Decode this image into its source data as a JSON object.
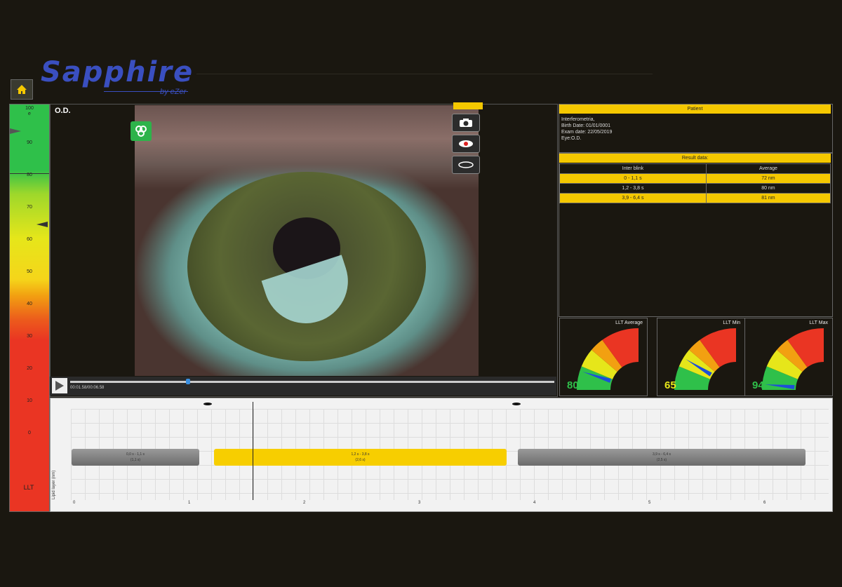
{
  "app": {
    "brand": "Sapphire",
    "brand_sub": "by eZer"
  },
  "llt_scale": {
    "ticks": [
      "100",
      "90",
      "80",
      "70",
      "60",
      "50",
      "40",
      "30",
      "20",
      "10",
      "0"
    ],
    "small_label": "e",
    "label": "LLT"
  },
  "video": {
    "eye_label": "O.D.",
    "time": "00:01.58/00:06.58"
  },
  "patient": {
    "header": "Patient",
    "name": "Interferometria,",
    "birth": "Birth Date: 01/01/0001",
    "exam": "Exam date: 22/05/2019",
    "eye": "Eye:O.D."
  },
  "result": {
    "header": "Result data:",
    "columns": [
      "Inter blink",
      "Average"
    ],
    "rows": [
      {
        "interval": "0 - 1,1 s",
        "avg": "72 nm"
      },
      {
        "interval": "1,2 - 3,8 s",
        "avg": "80 nm"
      },
      {
        "interval": "3,9 - 6,4 s",
        "avg": "81 nm"
      }
    ]
  },
  "gauges": [
    {
      "title": "LLT Average",
      "value": "80",
      "color": "#2fc04a"
    },
    {
      "title": "LLT Min",
      "value": "65",
      "color": "#e6e61a"
    },
    {
      "title": "LLT Max",
      "value": "94",
      "color": "#2fc04a"
    }
  ],
  "timeline": {
    "ylabel": "Lipid layer (nm)",
    "segments": [
      {
        "line1": "0,0 s - 1,1 s",
        "line2": "(1,1 s)"
      },
      {
        "line1": "1,2 s - 3,8 s",
        "line2": "(2,6 s)"
      },
      {
        "line1": "3,9 s - 6,4 s",
        "line2": "(2,5 s)"
      }
    ],
    "x_ticks": [
      "0",
      "1",
      "2",
      "3",
      "4",
      "5",
      "6"
    ]
  },
  "colors": {
    "accent_yellow": "#f5c800",
    "scale_green": "#2fc04a",
    "scale_red": "#ea3523"
  }
}
